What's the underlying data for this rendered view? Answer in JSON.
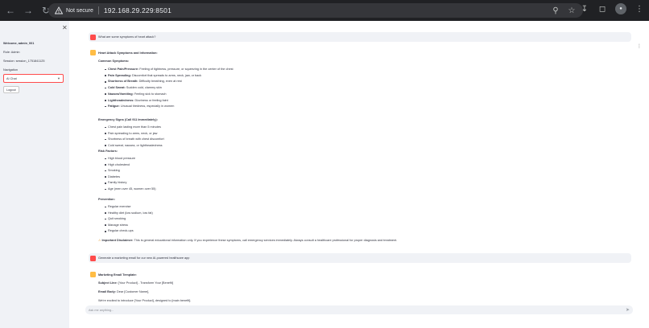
{
  "browser": {
    "not_secure": "Not secure",
    "url": "192.168.29.229:8501"
  },
  "sidebar": {
    "welcome": "Welcome, admin_001",
    "role": "Role: Admin",
    "session": "Session: session_1751841125",
    "nav_label": "Navigation",
    "nav_value": "AI Chat",
    "logout": "Logout"
  },
  "chat": {
    "q1": "What are some symptoms of heart attack?",
    "a1_title": "Heart Attack Symptoms and Information:",
    "common_title": "Common Symptoms:",
    "common": [
      {
        "k": "Chest Pain/Pressure:",
        "v": " Feeling of tightness, pressure, or squeezing in the center of the chest"
      },
      {
        "k": "Pain Spreading:",
        "v": " Discomfort that spreads to arms, neck, jaw, or back"
      },
      {
        "k": "Shortness of Breath:",
        "v": " Difficulty breathing, even at rest"
      },
      {
        "k": "Cold Sweat:",
        "v": " Sudden cold, clammy skin"
      },
      {
        "k": "Nausea/Vomiting:",
        "v": " Feeling sick to stomach"
      },
      {
        "k": "Lightheadedness:",
        "v": " Dizziness or feeling faint"
      },
      {
        "k": "Fatigue:",
        "v": " Unusual tiredness, especially in women"
      }
    ],
    "emergency_title": "Emergency Signs (Call 911 Immediately):",
    "emergency": [
      "Chest pain lasting more than 5 minutes",
      "Pain spreading to arms, neck, or jaw",
      "Shortness of breath with chest discomfort",
      "Cold sweat, nausea, or lightheadedness"
    ],
    "risk_title": "Risk Factors:",
    "risk": [
      "High blood pressure",
      "High cholesterol",
      "Smoking",
      "Diabetes",
      "Family history",
      "Age (men over 45, women over 55)"
    ],
    "prevention_title": "Prevention:",
    "prevention": [
      "Regular exercise",
      "Healthy diet (low sodium, low fat)",
      "Quit smoking",
      "Manage stress",
      "Regular check-ups"
    ],
    "disclaimer_k": "Important Disclaimer:",
    "disclaimer_v": " This is general educational information only. If you experience these symptoms, call emergency services immediately. Always consult a healthcare professional for proper diagnosis and treatment.",
    "q2": "Generate a marketing email for our new AI-powered healthcare app",
    "a2_title": "Marketing Email Template:",
    "subject_k": "Subject Line:",
    "subject_v": " [Your Product] - Transform Your [Benefit]",
    "body_k": "Email Body:",
    "body_v": " Dear [Customer Name],",
    "body_line": "We're excited to introduce [Your Product], designed to [main benefit].",
    "input_placeholder": "Ask me anything..."
  },
  "colors": {
    "accent": "#ff4b4b",
    "bot": "#ffbd45",
    "sidebar_bg": "#f0f2f6"
  }
}
